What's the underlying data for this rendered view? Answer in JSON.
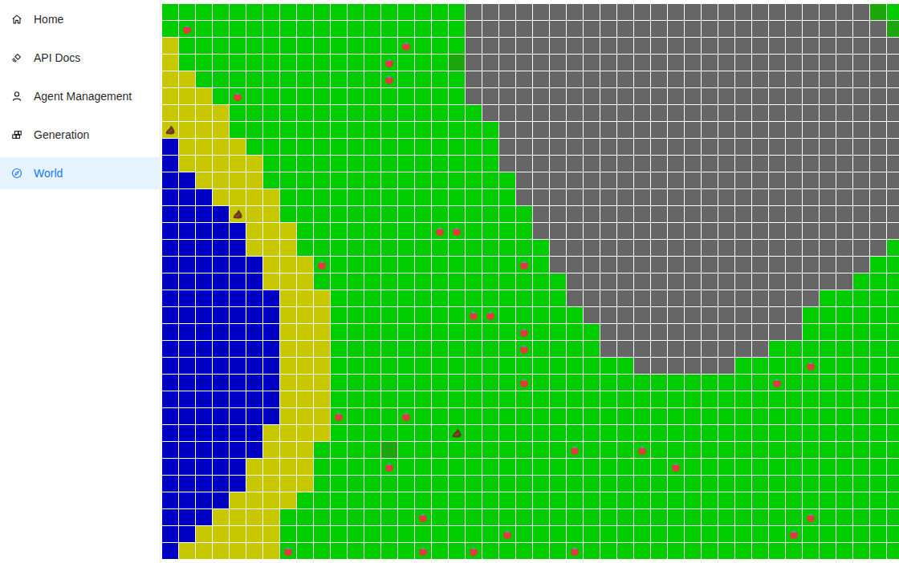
{
  "sidebar": {
    "items": [
      {
        "label": "Home",
        "selected": false
      },
      {
        "label": "API Docs",
        "selected": false
      },
      {
        "label": "Agent Management",
        "selected": false
      },
      {
        "label": "Generation",
        "selected": false
      },
      {
        "label": "World",
        "selected": true
      }
    ]
  },
  "world": {
    "tiles": [
      "GGGGGGGGGGGGGGGGGGRRRRRRRRRRRRRRRRRRRRRRRRDG",
      "GGGGGGGGGGGGGGGGGGRRRRRRRRRRRRRRRRRRRRRRRRRD",
      "SGGGGGGGGGGGGGGGGGRRRRRRRRRRRRRRRRRRRRRRRRRR",
      "SGGGGGGGGGGGGGGGGDRRRRRRRRRRRRRRRRRRRRRRRRRR",
      "SSGGGGGGGGGGGGGGGGRRRRRRRRRRRRRRRRRRRRRRRRRR",
      "SSSGGGGGGGGGGGGGGGRRRRRRRRRRRRRRRRRRRRRRRRRR",
      "SSSSGGGGGGGGGGGGGGGRRRRRRRRRRRRRRRRRRRRRRRRR",
      "SSSSGGGGGGGGGGGGGGGGRRRRRRRRRRRRRRRRRRRRRRRR",
      "WSSSSGGGGGGGGGGGGGGGRRRRRRRRRRRRRRRRRRRRRRRR",
      "WSSSSSGGGGGGGGGGGGGGRRRRRRRRRRRRRRRRRRRRRRRR",
      "WWSSSSGGGGGGGGGGGGGGGRRRRRRRRRRRRRRRRRRRRRRR",
      "WWWSSSSGGGGGGGGGGGGGGRRRRRRRRRRRRRRRRRRRRRRR",
      "WWWWSSSGGGGGGGGGGGGGGGRRRRRRRRRRRRRRRRRRRRRR",
      "WWWWWSSSGGGGGGGGGGGGGGRRRRRRRRRRRRRRRRRRRRRR",
      "WWWWWSSSGGGGGGGGGGGGGGGRRRRRRRRRRRRRRRRRRRRG",
      "WWWWWWSSSGGGGGGGGGGGGGGRRRRRRRRRRRRRRRRRRRGG",
      "WWWWWWSSSGGGGGGGGGGGGGGGRRRRRRRRRRRRRRRRRGGG",
      "WWWWWWWSSSGGGGGGGGGGGGGGRRRRRRRRRRRRRRRGGGGG",
      "WWWWWWWSSSGGGGGGGGGGGGGGGRRRRRRRRRRRRRGGGGGG",
      "WWWWWWWSSSGGGGGGGGGGGGGGGGRRRRRRRRRRRRGGGGGG",
      "WWWWWWWSSSGGGGGGGGGGGGGGGGRRRRRRRRRRGGGGGGGG",
      "WWWWWWWSSSGGGGGGGGGGGGGGGGGGRRRRRRGGGGGGGGGG",
      "WWWWWWWSSSGGGGGGGGGGGGGGGGGGGGGGGGGGGGGGGGGG",
      "WWWWWWWSSSGGGGGGGGGGGGGGGGGGGGGGGGGGGGGGGGGG",
      "WWWWWWWSSSGGGGGGGGGGGGGGGGGGGGGGGGGGGGGGGGGG",
      "WWWWWWSSSSGGGGGGGGGGGGGGGGGGGGGGGGGGGGGGGGGG",
      "WWWWWWSSSGGGGDGGGGGGGGGGGGGGGGGGGGGGGGGGGGGG",
      "WWWWWSSSSGGGGGGGGGGGGGGGGGGGGGGGGGGGGGGGGGGG",
      "WWWWWSSSSGGGGGGGGGGGGGGGGGGGGGGGGGGGGGGGGGGG",
      "WWWWSSSSGGGGGGGGGGGGGGGGGGGGGGGGGGGGGGGGGGGG",
      "WWWSSSSGGGGGGGGGGGGGGGGGGGGGGGGGGGGGGGGGGGGG",
      "WWSSSSSGGGGGGGGGGGGGGGGGGGGGGGGGGGGGGGGGGGGG",
      "WSSSSSSGGGGGGGGGGGGGGGGGGGGGGGGGGGGGGGGGGGGG"
    ],
    "objects": [
      {
        "kind": "tomato",
        "row": 1,
        "col": 1
      },
      {
        "kind": "tomato",
        "row": 2,
        "col": 14
      },
      {
        "kind": "tomato",
        "row": 3,
        "col": 13
      },
      {
        "kind": "tomato",
        "row": 4,
        "col": 13
      },
      {
        "kind": "tomato",
        "row": 5,
        "col": 4
      },
      {
        "kind": "poop",
        "row": 7,
        "col": 0
      },
      {
        "kind": "poop",
        "row": 12,
        "col": 4
      },
      {
        "kind": "tomato",
        "row": 13,
        "col": 16
      },
      {
        "kind": "tomato",
        "row": 13,
        "col": 17
      },
      {
        "kind": "tomato",
        "row": 15,
        "col": 9
      },
      {
        "kind": "tomato",
        "row": 15,
        "col": 21
      },
      {
        "kind": "tomato",
        "row": 18,
        "col": 18
      },
      {
        "kind": "tomato",
        "row": 18,
        "col": 19
      },
      {
        "kind": "tomato",
        "row": 19,
        "col": 21
      },
      {
        "kind": "tomato",
        "row": 20,
        "col": 21
      },
      {
        "kind": "tomato",
        "row": 21,
        "col": 38
      },
      {
        "kind": "tomato",
        "row": 22,
        "col": 21
      },
      {
        "kind": "tomato",
        "row": 22,
        "col": 36
      },
      {
        "kind": "tomato",
        "row": 24,
        "col": 10
      },
      {
        "kind": "tomato",
        "row": 24,
        "col": 14
      },
      {
        "kind": "poop",
        "row": 25,
        "col": 17
      },
      {
        "kind": "tomato",
        "row": 26,
        "col": 24
      },
      {
        "kind": "tomato",
        "row": 26,
        "col": 28
      },
      {
        "kind": "tomato",
        "row": 27,
        "col": 13
      },
      {
        "kind": "tomato",
        "row": 27,
        "col": 30
      },
      {
        "kind": "tomato",
        "row": 30,
        "col": 15
      },
      {
        "kind": "tomato",
        "row": 30,
        "col": 38
      },
      {
        "kind": "tomato",
        "row": 31,
        "col": 20
      },
      {
        "kind": "tomato",
        "row": 31,
        "col": 37
      },
      {
        "kind": "tomato",
        "row": 32,
        "col": 7
      },
      {
        "kind": "tomato",
        "row": 32,
        "col": 15
      },
      {
        "kind": "tomato",
        "row": 32,
        "col": 18
      },
      {
        "kind": "tomato",
        "row": 32,
        "col": 24
      }
    ]
  }
}
